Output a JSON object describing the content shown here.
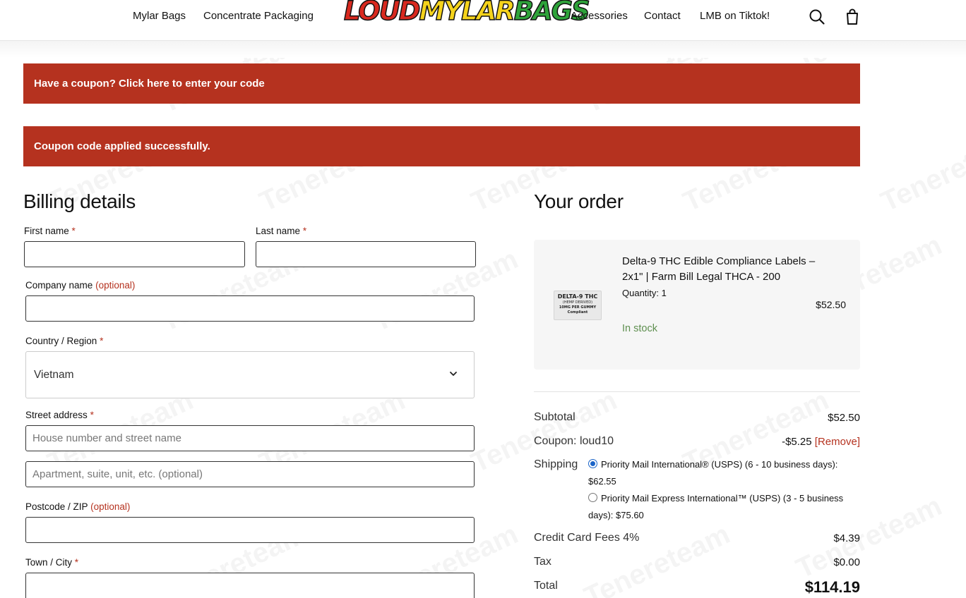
{
  "nav": {
    "left": [
      "Mylar Bags",
      "Concentrate Packaging"
    ],
    "right": [
      "Accessories",
      "Contact",
      "LMB on Tiktok!"
    ],
    "logo_parts": [
      "LOUD",
      "MYLAR",
      "BAGS"
    ]
  },
  "notices": {
    "coupon_prompt": "Have a coupon? Click here to enter your code",
    "coupon_success": "Coupon code applied successfully."
  },
  "billing": {
    "heading": "Billing details",
    "first_name_label": "First name",
    "last_name_label": "Last name",
    "company_label": "Company name",
    "optional": "(optional)",
    "country_label": "Country / Region",
    "country_value": "Vietnam",
    "street_label": "Street address",
    "street_placeholder": "House number and street name",
    "apt_placeholder": "Apartment, suite, unit, etc. (optional)",
    "postcode_label": "Postcode / ZIP",
    "town_label": "Town / City",
    "required_mark": "*"
  },
  "order": {
    "heading": "Your order",
    "product": {
      "title": "Delta-9 THC Edible Compliance Labels – 2x1\" | Farm Bill Legal THCA - 200",
      "quantity": "Quantity: 1",
      "price": "$52.50",
      "stock": "In stock",
      "thumb_lines": [
        "DELTA-9 THC",
        "(HEMP DERIVED)",
        "10MG PER GUMMY",
        "Compliant"
      ]
    },
    "subtotal_label": "Subtotal",
    "subtotal_value": "$52.50",
    "coupon_label": "Coupon: loud10",
    "coupon_value": "-$5.25",
    "remove_label": "[Remove]",
    "shipping_label": "Shipping",
    "shipping_option_1": "Priority Mail International® (USPS) (6 - 10 business days):",
    "shipping_option_1_price": "$62.55",
    "shipping_option_2": "Priority Mail Express International™ (USPS) (3 - 5 business",
    "shipping_option_2_price": "days): $75.60",
    "fees_label": "Credit Card Fees 4%",
    "fees_value": "$4.39",
    "tax_label": "Tax",
    "tax_value": "$0.00",
    "total_label": "Total",
    "total_value": "$114.19"
  },
  "watermark": "Tenereteam",
  "icons": [
    "search-icon",
    "cart-icon",
    "chevron-down-icon"
  ]
}
